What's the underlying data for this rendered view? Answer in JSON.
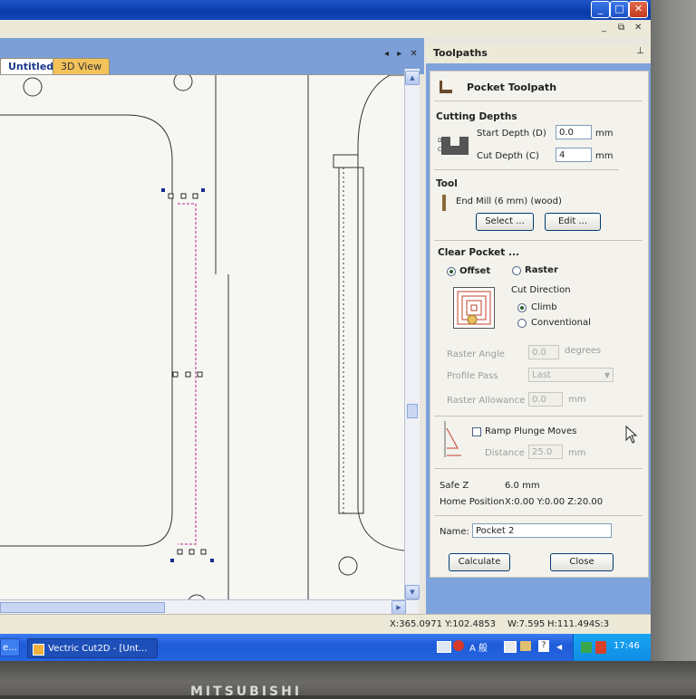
{
  "window": {
    "controls": [
      "_",
      "□",
      "✕"
    ],
    "mdi_controls": [
      "_",
      "⧉",
      "✕"
    ]
  },
  "tabs": {
    "untitled": "Untitled",
    "view3d": "3D View",
    "nav": "◂ ▸ ✕"
  },
  "toolpaths_panel": {
    "title": "Toolpaths",
    "pin": "⊥",
    "heading": "Pocket Toolpath",
    "cutting_depths": {
      "label": "Cutting Depths",
      "start_depth_label": "Start Depth (D)",
      "start_depth_value": "0.0",
      "start_unit": "mm",
      "cut_depth_label": "Cut Depth (C)",
      "cut_depth_value": "4",
      "cut_unit": "mm"
    },
    "tool": {
      "label": "Tool",
      "name": "End Mill (6 mm) (wood)",
      "select_button": "Select ...",
      "edit_button": "Edit ..."
    },
    "clear_pocket": {
      "label": "Clear Pocket ...",
      "offset_label": "Offset",
      "raster_label": "Raster",
      "cut_direction_label": "Cut Direction",
      "climb_label": "Climb",
      "conventional_label": "Conventional",
      "raster_angle_label": "Raster Angle",
      "raster_angle_value": "0.0",
      "raster_angle_unit": "degrees",
      "profile_pass_label": "Profile Pass",
      "profile_pass_value": "Last",
      "raster_allowance_label": "Raster Allowance",
      "raster_allowance_value": "0.0",
      "raster_allowance_unit": "mm"
    },
    "ramp": {
      "ramp_label": "Ramp Plunge Moves",
      "distance_label": "Distance",
      "distance_value": "25.0",
      "distance_unit": "mm"
    },
    "safe_z_label": "Safe Z",
    "safe_z_value": "6.0 mm",
    "home_position_label": "Home Position",
    "home_position_value": "X:0.00 Y:0.00 Z:20.00",
    "name_label": "Name:",
    "name_value": "Pocket 2",
    "calculate_button": "Calculate",
    "close_button": "Close"
  },
  "status_bar": {
    "coords": "X:365.0971 Y:102.4853",
    "width": "W:7.595",
    "height": "H:111.494",
    "s": "S:3"
  },
  "taskbar": {
    "left_task": "e...",
    "active_task": "Vectric Cut2D - [Unt...",
    "ime": "A 般",
    "clock": "17:46"
  },
  "monitor_brand": "MITSUBISHI"
}
